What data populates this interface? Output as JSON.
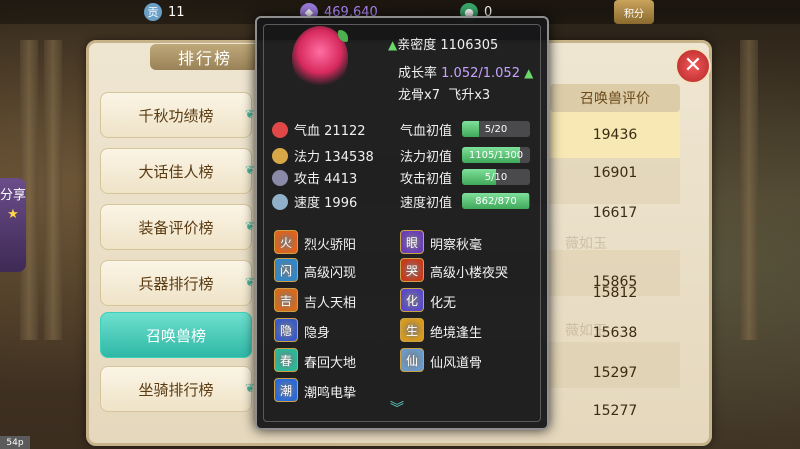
{
  "topbar": {
    "coin_value": "11",
    "silver_value": "469,640",
    "jade_value": "0",
    "rank_badge": "积分"
  },
  "ranking": {
    "title": "排行榜",
    "share_label": "分享",
    "menu": [
      {
        "label": "千秋功绩榜",
        "active": false
      },
      {
        "label": "大话佳人榜",
        "active": false
      },
      {
        "label": "装备评价榜",
        "active": false
      },
      {
        "label": "兵器排行榜",
        "active": false
      },
      {
        "label": "召唤兽榜",
        "active": true
      },
      {
        "label": "坐骑排行榜",
        "active": false
      }
    ],
    "score_header": "召唤兽评价",
    "scores": [
      "19436",
      "16901",
      "16617",
      "15865",
      "15812",
      "15638",
      "15297",
      "15277"
    ],
    "owner_ghost": "薇如玉"
  },
  "pet": {
    "intimacy_label": "亲密度",
    "intimacy_value": "1106305",
    "growth_label": "成长率",
    "growth_value": "1.052/1.052",
    "dragon_bone": "龙骨x7",
    "ascend": "飞升x3",
    "stats": [
      {
        "label": "气血",
        "value": "21122",
        "init_label": "气血初值",
        "bar_text": "5/20",
        "fill": 0.25,
        "color": "#e04848",
        "icon": "heart-icon"
      },
      {
        "label": "法力",
        "value": "134538",
        "init_label": "法力初值",
        "bar_text": "1105/1300",
        "fill": 0.85,
        "color": "#d8a848",
        "icon": "mana-icon"
      },
      {
        "label": "攻击",
        "value": "4413",
        "init_label": "攻击初值",
        "bar_text": "5/10",
        "fill": 0.5,
        "color": "#8a8aa8",
        "icon": "sword-icon"
      },
      {
        "label": "速度",
        "value": "1996",
        "init_label": "速度初值",
        "bar_text": "862/870",
        "fill": 0.99,
        "color": "#8fb0c8",
        "icon": "speed-icon"
      }
    ],
    "skills": [
      {
        "name": "烈火骄阳",
        "color": "#e0621c",
        "glyph": "火"
      },
      {
        "name": "明察秋毫",
        "color": "#6a3fb8",
        "glyph": "眼"
      },
      {
        "name": "高级闪现",
        "color": "#2f86c8",
        "glyph": "闪"
      },
      {
        "name": "高级小楼夜哭",
        "color": "#c83a1c",
        "glyph": "哭"
      },
      {
        "name": "吉人天相",
        "color": "#d86a1c",
        "glyph": "吉"
      },
      {
        "name": "化无",
        "color": "#5a4ac8",
        "glyph": "化"
      },
      {
        "name": "隐身",
        "color": "#3a5ac8",
        "glyph": "隐"
      },
      {
        "name": "绝境逢生",
        "color": "#d89a1c",
        "glyph": "生"
      },
      {
        "name": "春回大地",
        "color": "#2ab89a",
        "glyph": "春"
      },
      {
        "name": "仙风道骨",
        "color": "#6a9ac8",
        "glyph": "仙"
      },
      {
        "name": "潮鸣电挚",
        "color": "#2a6ad8",
        "glyph": "潮"
      }
    ]
  },
  "bottom_tag": "54p"
}
